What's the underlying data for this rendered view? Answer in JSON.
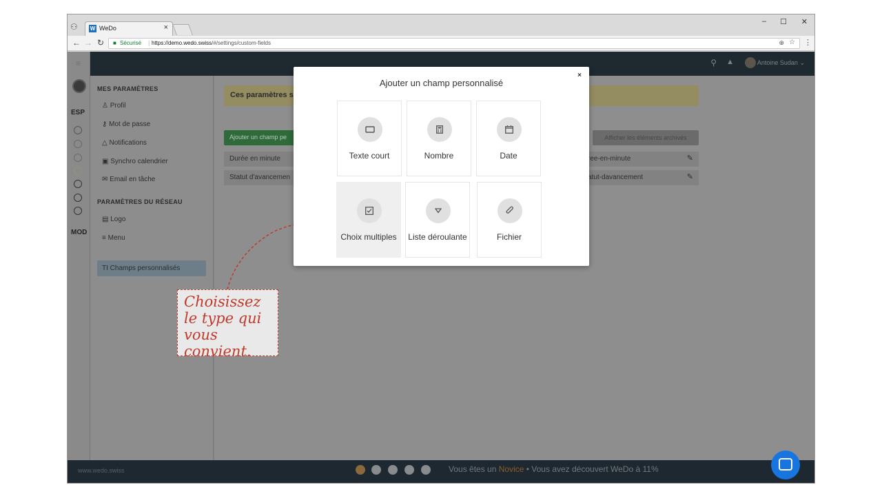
{
  "browser": {
    "tab_title": "WeDo",
    "tab_favicon": "W",
    "secure_label": "Sécurisé",
    "url_domain": "https://demo.wedo.swiss",
    "url_path": "/#/settings/custom-fields"
  },
  "header": {
    "user_name": "Antoine Sudan"
  },
  "leftbar": {
    "labels": [
      "ESP",
      "MOD"
    ]
  },
  "settings": {
    "my_settings_title": "MES PARAMÈTRES",
    "my_items": [
      "Profil",
      "Mot de passe",
      "Notifications",
      "Synchro calendrier",
      "Email en tâche"
    ],
    "network_title": "PARAMÈTRES DU RÉSEAU",
    "network_items": [
      "Logo",
      "Menu",
      "Champs personnalisés"
    ]
  },
  "main": {
    "banner": "Ces paramètres s",
    "add_button": "Ajouter un champ pe",
    "archived_button": "Afficher les éléments archivés",
    "rows": [
      {
        "name": "Durée en minute",
        "key": "ree-en-minute"
      },
      {
        "name": "Statut d'avancemen",
        "key": "atut-davancement"
      }
    ]
  },
  "modal": {
    "title": "Ajouter un champ personnalisé",
    "close": "×",
    "types": [
      {
        "label": "Texte court",
        "icon": "text-input-icon"
      },
      {
        "label": "Nombre",
        "icon": "calculator-icon"
      },
      {
        "label": "Date",
        "icon": "calendar-icon"
      },
      {
        "label": "Choix multiples",
        "icon": "checkbox-icon"
      },
      {
        "label": "Liste déroulante",
        "icon": "dropdown-icon"
      },
      {
        "label": "Fichier",
        "icon": "paperclip-icon"
      }
    ]
  },
  "footer": {
    "brand": "www.wedo.swiss",
    "status_prefix": "Vous êtes un ",
    "status_level": "Novice",
    "status_suffix": " • Vous avez découvert WeDo à 11%",
    "progress_steps": 5,
    "progress_level": 1
  },
  "callout": {
    "text": "Choisissez le type qui vous convient."
  },
  "colors": {
    "accent_blue": "#1875e0",
    "callout_red": "#c0392b",
    "novice_orange": "#8a5e2c"
  }
}
